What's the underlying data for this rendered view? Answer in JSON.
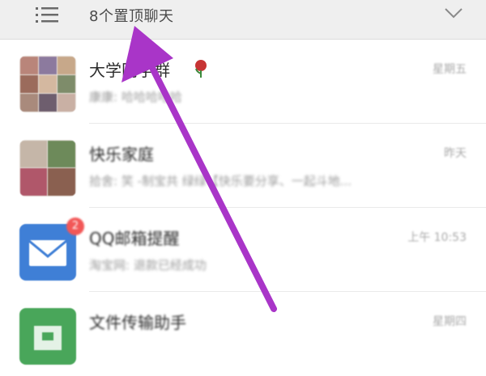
{
  "header": {
    "title": "8个置顶聊天"
  },
  "chats": [
    {
      "name": "大学同学群",
      "preview": "康康: 哈哈哈哈哈",
      "time": "星期五"
    },
    {
      "name": "快乐家庭",
      "preview": "拾舍: 笑 -制宝共 绿绿【快乐要分享、一起斗地...",
      "time": "昨天"
    },
    {
      "name": "QQ邮箱提醒",
      "preview": "淘宝网: 退款已经成功",
      "time": "上午 10:53",
      "badge": "2"
    },
    {
      "name": "文件传输助手",
      "preview": "",
      "time": "星期四"
    }
  ],
  "colors": {
    "header_bg": "#efefef",
    "mail_blue": "#3f7fd6",
    "file_green": "#49a65a",
    "badge_red": "#f25757",
    "arrow_purple": "#a935c8"
  }
}
